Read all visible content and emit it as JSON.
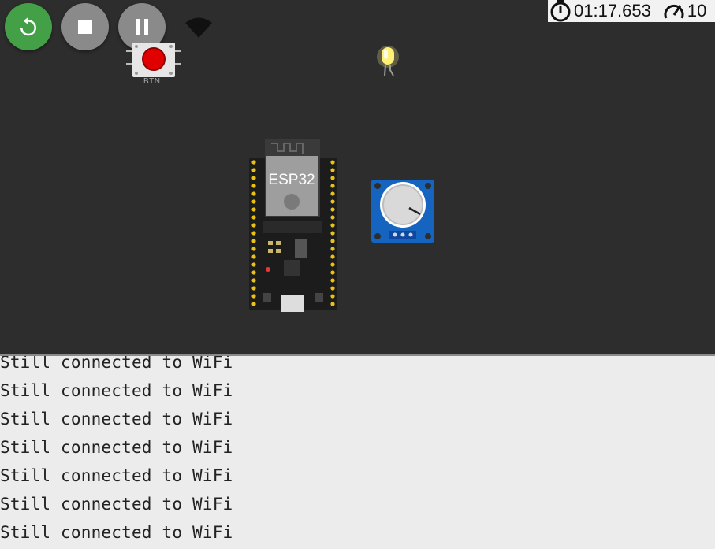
{
  "toolbar": {
    "restart_icon": "restart-icon",
    "stop_icon": "stop-icon",
    "pause_icon": "pause-icon",
    "wifi_icon": "wifi-icon"
  },
  "status": {
    "timer": "01:17.653",
    "speed": "10"
  },
  "components": {
    "button_label": "BTN",
    "esp_label": "ESP32",
    "led_color": "#fff176",
    "button_color": "#e00000"
  },
  "serial_monitor": {
    "lines": [
      "Still connected to WiFi",
      "Still connected to WiFi",
      "Still connected to WiFi",
      "Still connected to WiFi",
      "Still connected to WiFi",
      "Still connected to WiFi",
      "Still connected to WiFi"
    ]
  },
  "colors": {
    "canvas_bg": "#2d2d2d",
    "restart_green": "#43a047",
    "serial_bg": "#ececec"
  }
}
